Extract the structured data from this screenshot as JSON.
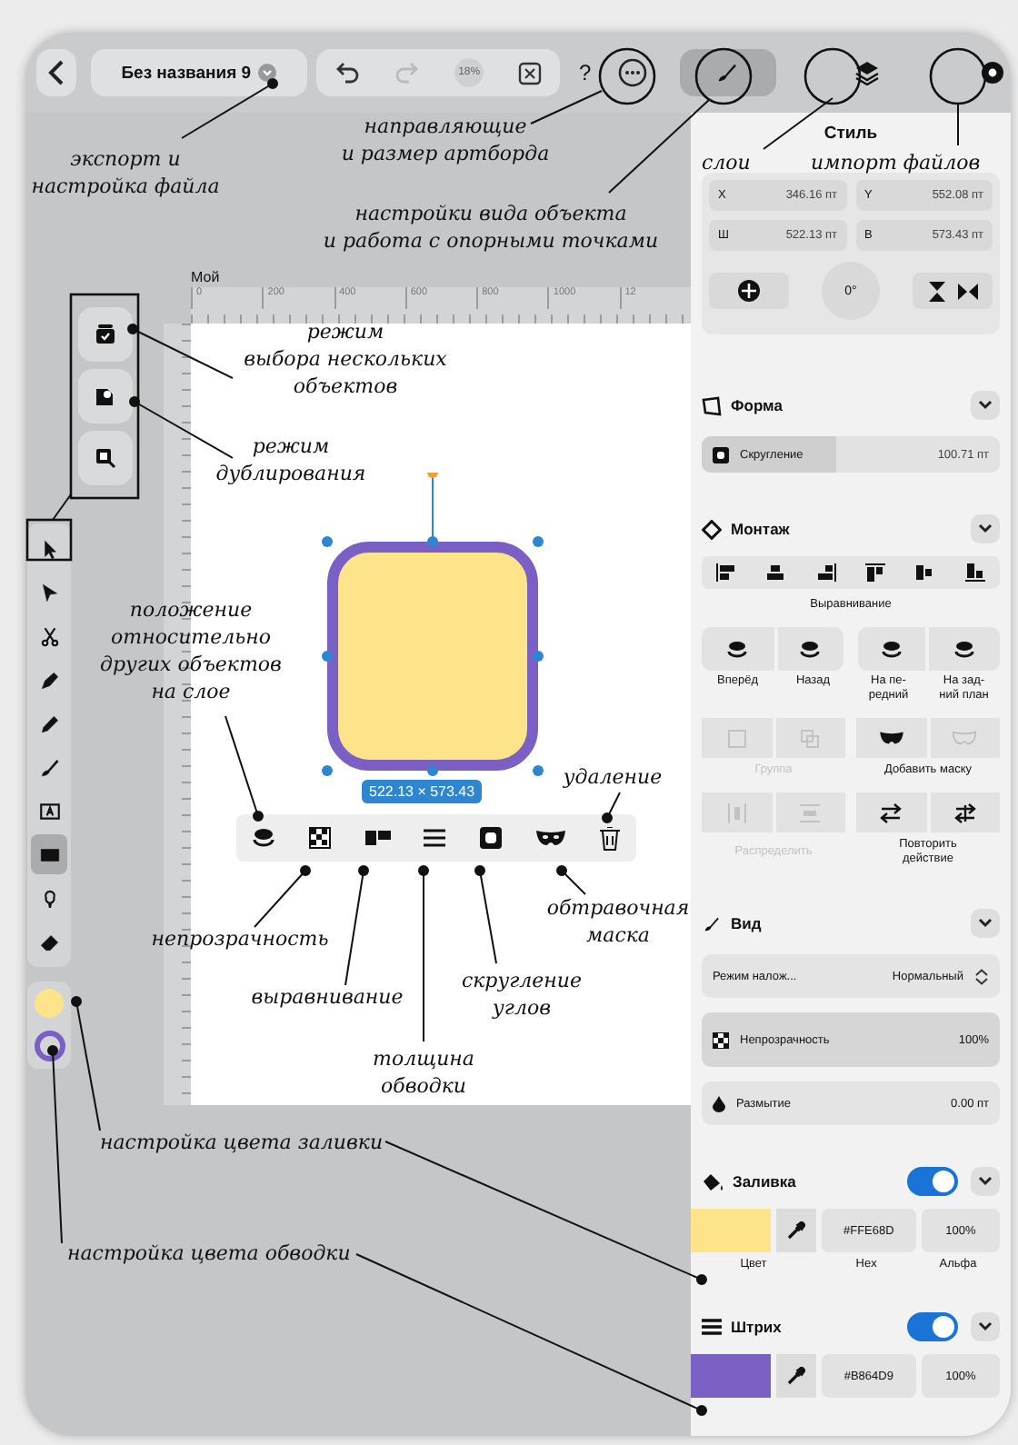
{
  "top_bar": {
    "document_title": "Без названия 9",
    "zoom": "18%",
    "help": "?"
  },
  "tools": [
    {
      "kind": "select",
      "selected": false
    },
    {
      "kind": "direct",
      "selected": false
    },
    {
      "kind": "scissors",
      "selected": false
    },
    {
      "kind": "pen",
      "selected": false
    },
    {
      "kind": "pencil",
      "selected": false
    },
    {
      "kind": "brush",
      "selected": false
    },
    {
      "kind": "text",
      "selected": false
    },
    {
      "kind": "rectangle",
      "selected": true
    },
    {
      "kind": "builder",
      "selected": false
    },
    {
      "kind": "eraser",
      "selected": false
    }
  ],
  "canvas": {
    "artboard_label": "Мой",
    "ruler_ticks": [
      "0",
      "200",
      "400",
      "600",
      "800",
      "1000",
      "12"
    ],
    "selection_size": "522.13 × 573.43"
  },
  "style_panel": {
    "title": "Стиль",
    "fields": [
      {
        "label": "X",
        "value": "346.16 пт"
      },
      {
        "label": "Y",
        "value": "552.08 пт"
      },
      {
        "label": "Ш",
        "value": "522.13 пт"
      },
      {
        "label": "В",
        "value": "573.43 пт"
      }
    ],
    "rotation": "0°",
    "shape_section": {
      "title": "Форма",
      "corner": {
        "label": "Скругление",
        "value": "100.71 пт",
        "level": 0.45
      }
    },
    "arrange_section": {
      "title": "Монтаж",
      "align_label": "Выравнивание",
      "order_buttons": [
        {
          "label": "Вперёд"
        },
        {
          "label": "Назад"
        },
        {
          "label": "На пе-\nредний"
        },
        {
          "label": "На зад-\nний план"
        }
      ],
      "group": {
        "label": "Группа",
        "disabled": true
      },
      "mask": {
        "label": "Добавить маску",
        "disabled": false
      },
      "distribute": {
        "label": "Распределить",
        "disabled": true
      },
      "repeat": {
        "label": "Повторить\nдействие",
        "disabled": false
      }
    },
    "view_section": {
      "title": "Вид",
      "blend_label": "Режим налож...",
      "blend_value": "Нормальный",
      "opacity": {
        "label": "Непрозрачность",
        "value": "100%"
      },
      "blur": {
        "label": "Размытие",
        "value": "0.00 пт"
      }
    },
    "fill_section": {
      "title": "Заливка",
      "on": true,
      "hex": "#FFE68D",
      "alpha": "100%",
      "labels": [
        "Цвет",
        "Hex",
        "Альфа"
      ]
    },
    "stroke_section": {
      "title": "Штрих",
      "on": true,
      "hex": "#B864D9",
      "alpha": "100%"
    }
  },
  "annotations": [
    "экспорт и\nнастройка файла",
    "направляющие\nи размер артборда",
    "настройки вида объекта\nи работа с опорными точками",
    "слои",
    "импорт файлов",
    "режим\nвыбора нескольких\nобъектов",
    "режим\nдублирования",
    "положение\nотносительно\nдругих объектов\nна слое",
    "удаление",
    "непрозрачность",
    "выравнивание",
    "толщина\nобводки",
    "скругление\nуглов",
    "обтравочная\nмаска",
    "настройка цвета заливки",
    "настройка цвета обводки"
  ]
}
